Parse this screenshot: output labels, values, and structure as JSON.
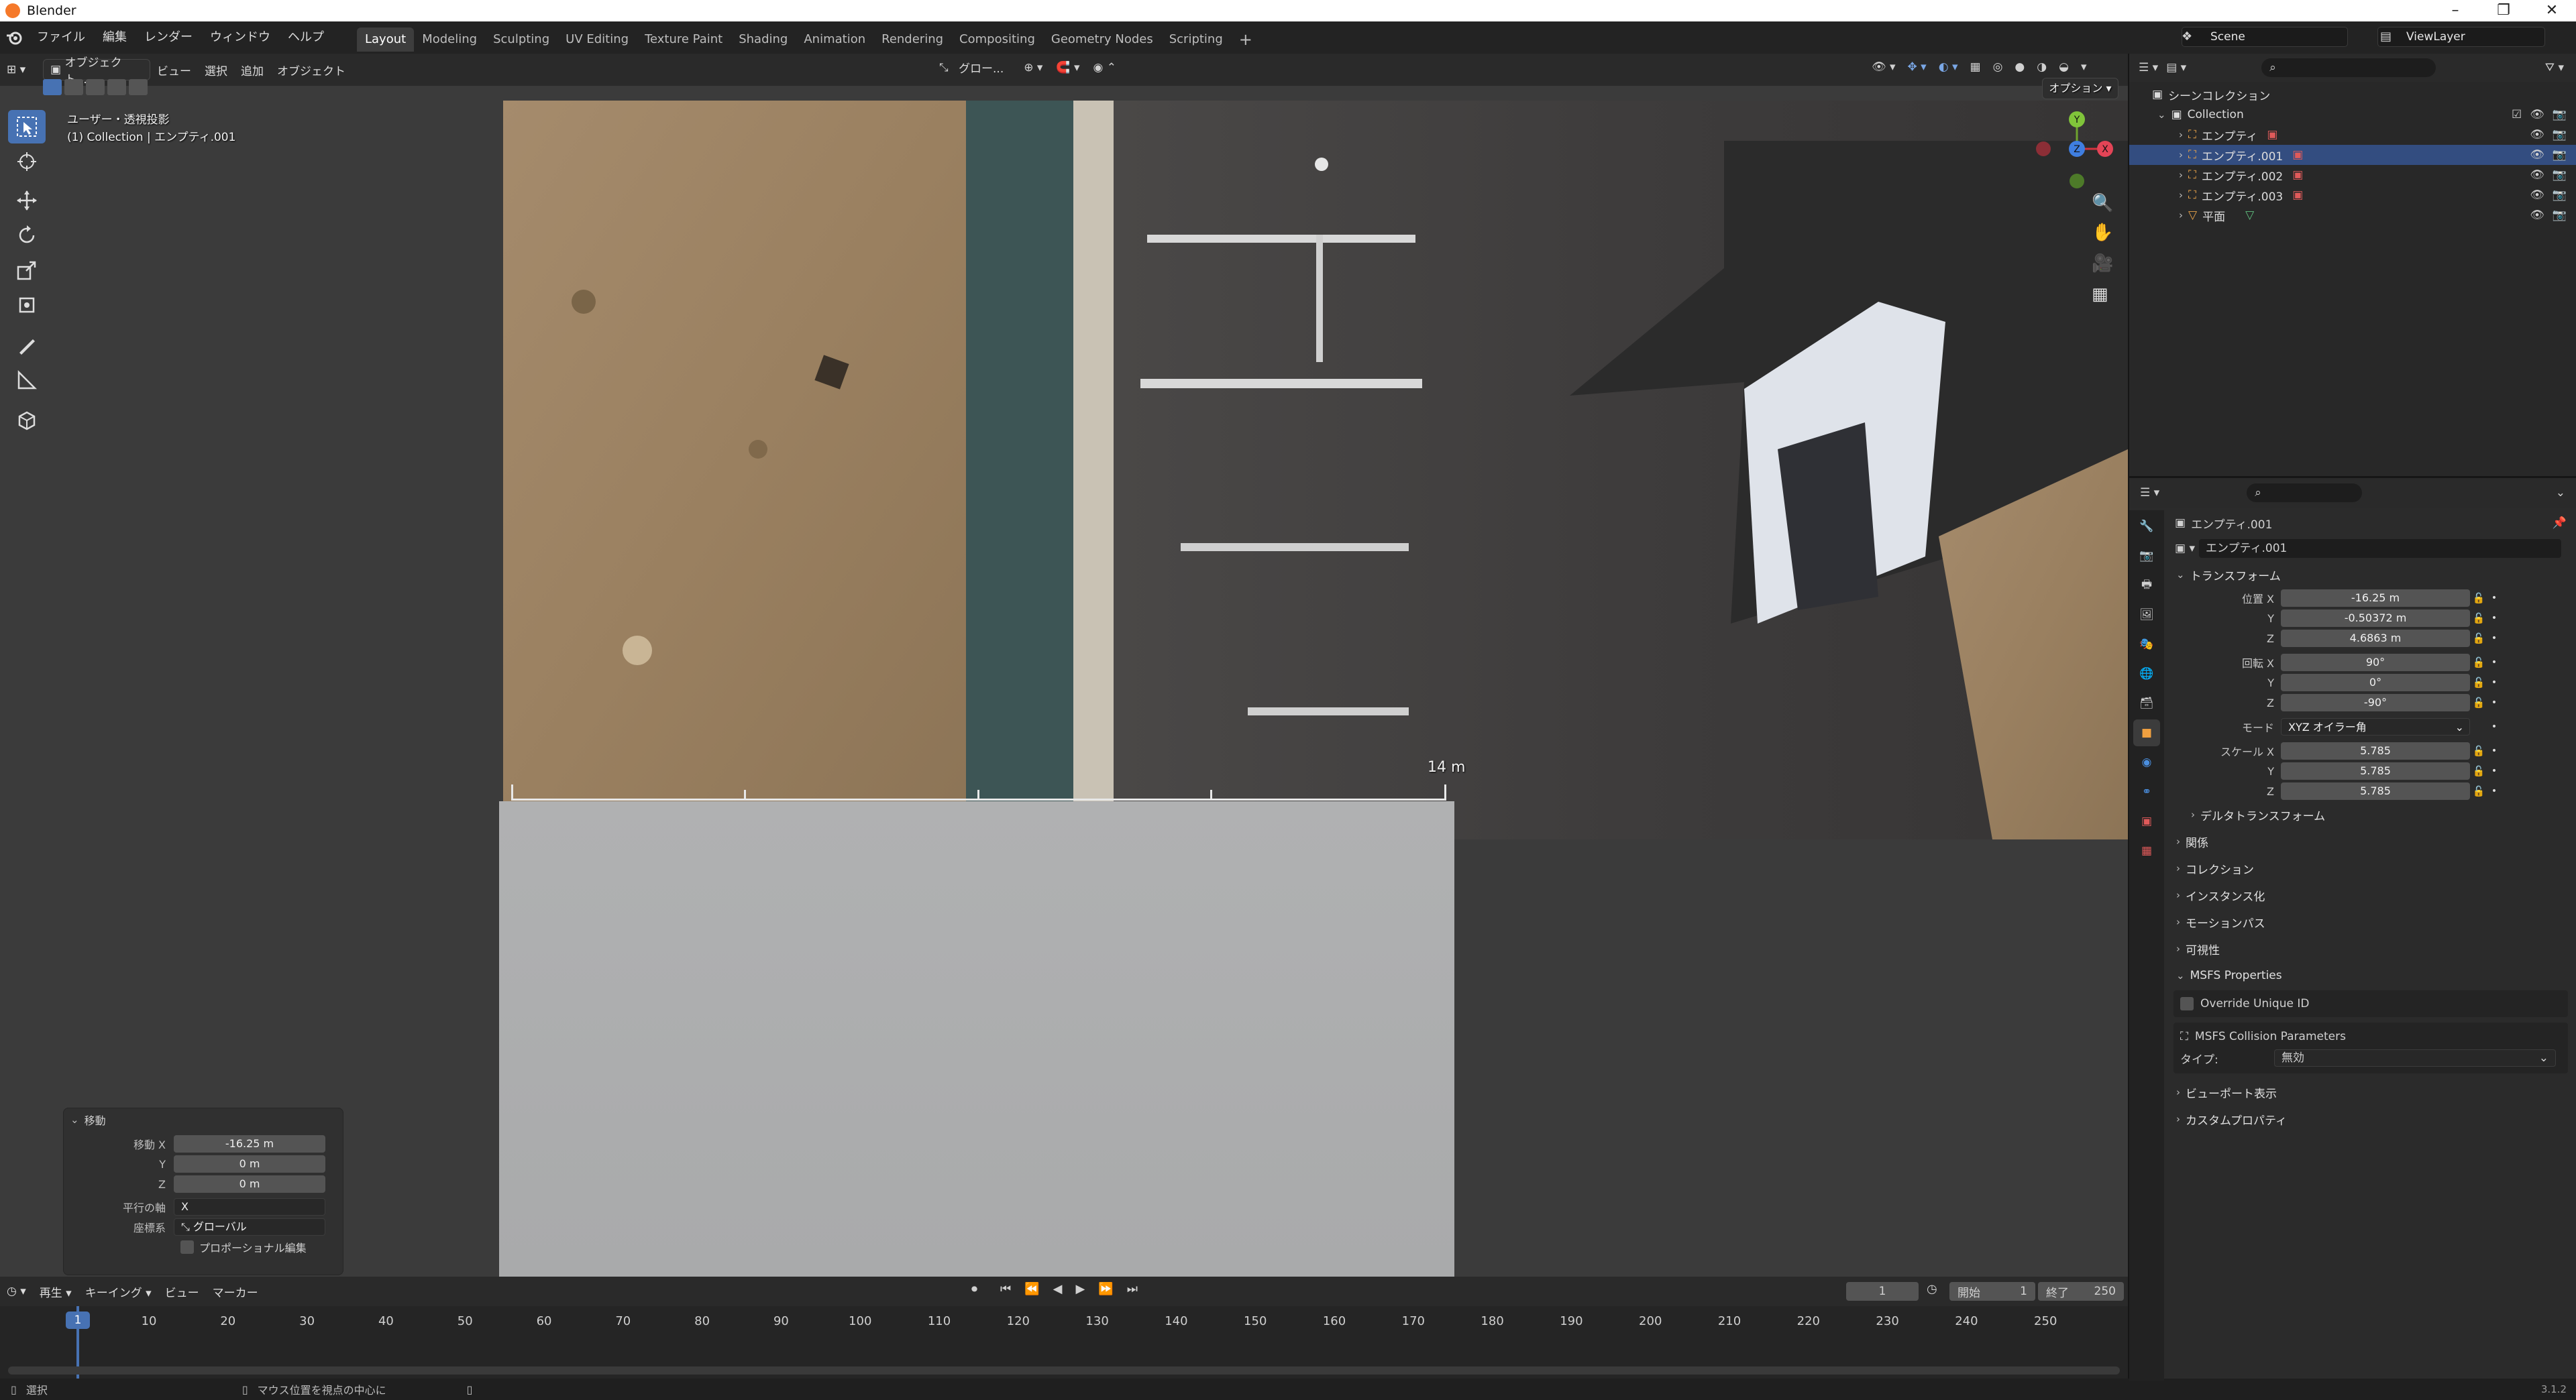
{
  "os": {
    "title": "Blender"
  },
  "menu": [
    "ファイル",
    "編集",
    "レンダー",
    "ウィンドウ",
    "ヘルプ"
  ],
  "workspaces": [
    "Layout",
    "Modeling",
    "Sculpting",
    "UV Editing",
    "Texture Paint",
    "Shading",
    "Animation",
    "Rendering",
    "Compositing",
    "Geometry Nodes",
    "Scripting"
  ],
  "scene": {
    "scene_name": "Scene",
    "view_layer": "ViewLayer"
  },
  "viewport": {
    "mode": "オブジェクト...",
    "menus": [
      "ビュー",
      "選択",
      "追加",
      "オブジェクト"
    ],
    "transform_orient": "グロー...",
    "options": "オプション",
    "view_label": "ユーザー・透視投影",
    "collection_label": "(1) Collection | エンプティ.001",
    "ruler_label": "14 m",
    "gizmo": {
      "x": "X",
      "y": "Y",
      "z": "Z"
    }
  },
  "redo_panel": {
    "title": "移動",
    "move_x_label": "移動 X",
    "move_x": "-16.25 m",
    "y_label": "Y",
    "y": "0 m",
    "z_label": "Z",
    "z": "0 m",
    "axis_label": "平行の軸",
    "axis": "X",
    "orient_label": "座標系",
    "orient": "グローバル",
    "proportional_label": "プロポーショナル編集"
  },
  "timeline": {
    "menus": [
      "再生",
      "キーイング",
      "ビュー",
      "マーカー"
    ],
    "current_frame": "1",
    "start_label": "開始",
    "start": "1",
    "end_label": "終了",
    "end": "250",
    "ticks": [
      "1",
      "10",
      "20",
      "30",
      "40",
      "50",
      "60",
      "70",
      "80",
      "90",
      "100",
      "110",
      "120",
      "130",
      "140",
      "150",
      "160",
      "170",
      "180",
      "190",
      "200",
      "210",
      "220",
      "230",
      "240",
      "250"
    ]
  },
  "status": {
    "left": "選択",
    "middle": "マウス位置を視点の中心に",
    "version": "3.1.2"
  },
  "outliner": {
    "root": "シーンコレクション",
    "collection": "Collection",
    "items": [
      {
        "name": "エンプティ",
        "selected": false
      },
      {
        "name": "エンプティ.001",
        "selected": true
      },
      {
        "name": "エンプティ.002",
        "selected": false
      },
      {
        "name": "エンプティ.003",
        "selected": false
      },
      {
        "name": "平面",
        "selected": false
      }
    ]
  },
  "properties": {
    "object_name": "エンプティ.001",
    "object_field": "エンプティ.001",
    "transform_title": "トランスフォーム",
    "location_label": "位置 X",
    "loc_x": "-16.25 m",
    "loc_y": "-0.50372 m",
    "loc_z": "4.6863 m",
    "rotation_label": "回転 X",
    "rot_x": "90°",
    "rot_y": "0°",
    "rot_z": "-90°",
    "mode_label": "モード",
    "mode": "XYZ オイラー角",
    "scale_label": "スケール X",
    "scale_x": "5.785",
    "scale_y": "5.785",
    "scale_z": "5.785",
    "y_label": "Y",
    "z_label": "Z",
    "delta": "デルタトランスフォーム",
    "sections": [
      "関係",
      "コレクション",
      "インスタンス化",
      "モーションパス",
      "可視性"
    ],
    "msfs_title": "MSFS Properties",
    "override_uid": "Override Unique ID",
    "collision_params": "MSFS Collision Parameters",
    "type_label": "タイプ:",
    "type_value": "無効",
    "sections2": [
      "ビューポート表示",
      "カスタムプロパティ"
    ]
  },
  "colors": {
    "accent": "#4772b3",
    "selection": "#334d80",
    "viewport_bg": "#3b3b3b"
  }
}
